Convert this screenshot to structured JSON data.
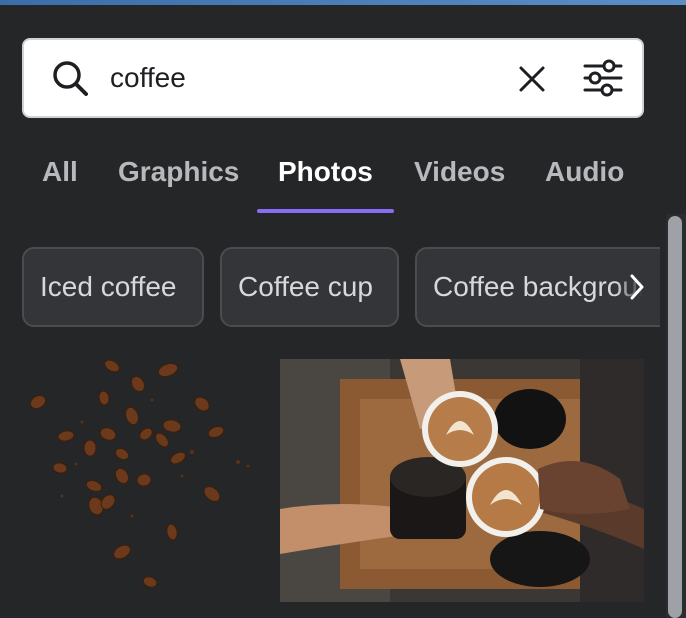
{
  "search": {
    "value": "coffee",
    "icons": {
      "search": "search-icon",
      "clear": "close-icon",
      "filter": "sliders-icon"
    }
  },
  "tabs": [
    {
      "label": "All",
      "active": false
    },
    {
      "label": "Graphics",
      "active": false
    },
    {
      "label": "Photos",
      "active": true
    },
    {
      "label": "Videos",
      "active": false
    },
    {
      "label": "Audio",
      "active": false
    }
  ],
  "chips": [
    {
      "label": "Iced coffee"
    },
    {
      "label": "Coffee cup"
    },
    {
      "label": "Coffee background"
    }
  ],
  "results": [
    {
      "kind": "graphic",
      "subject": "coffee-beans"
    },
    {
      "kind": "photo",
      "subject": "coffee-cups-toast"
    }
  ],
  "colors": {
    "background": "#252627",
    "active_tab_underline": "#8b6df5",
    "chip_background": "#333538",
    "search_background": "#ffffff"
  }
}
